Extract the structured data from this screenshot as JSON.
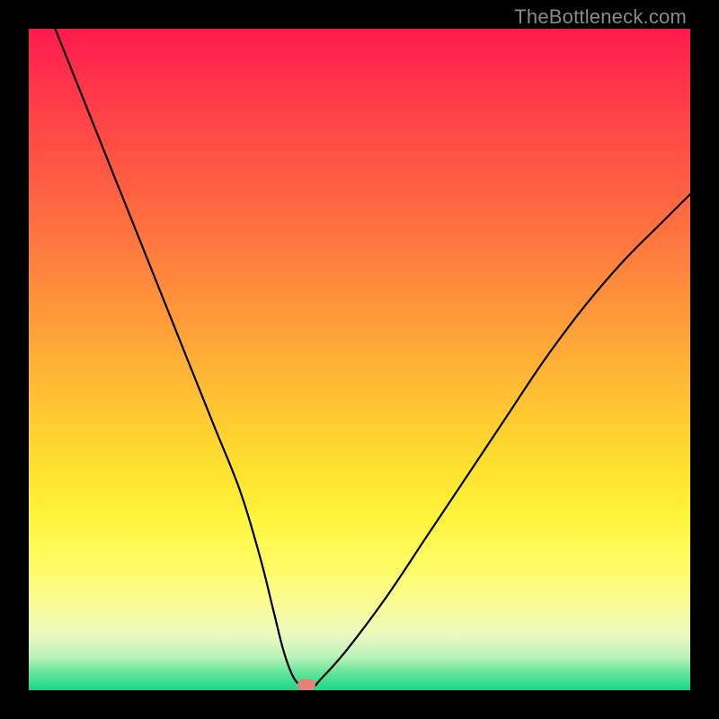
{
  "watermark": "TheBottleneck.com",
  "colors": {
    "frame": "#000000",
    "curve": "#000000",
    "marker": "#e6817a",
    "gradient_top": "#ff1a4d",
    "gradient_mid": "#ffe02e",
    "gradient_bottom": "#1ad88a"
  },
  "chart_data": {
    "type": "line",
    "title": "",
    "xlabel": "",
    "ylabel": "",
    "xlim": [
      0,
      100
    ],
    "ylim": [
      0,
      100
    ],
    "grid": false,
    "legend": false,
    "series": [
      {
        "name": "bottleneck-curve",
        "x": [
          4,
          8,
          12,
          16,
          20,
          24,
          28,
          32,
          35,
          37,
          38.5,
          40,
          41.5,
          43,
          44,
          48,
          54,
          60,
          66,
          72,
          78,
          84,
          90,
          96,
          100
        ],
        "values": [
          100,
          90,
          80,
          70,
          60,
          50,
          40,
          30,
          20,
          12,
          6,
          2,
          0.5,
          0.5,
          1.5,
          6,
          14,
          23,
          32,
          41,
          50,
          58,
          65,
          71,
          75
        ]
      }
    ],
    "annotations": [
      {
        "name": "min-marker",
        "x": 42,
        "y": 0.8
      }
    ]
  }
}
